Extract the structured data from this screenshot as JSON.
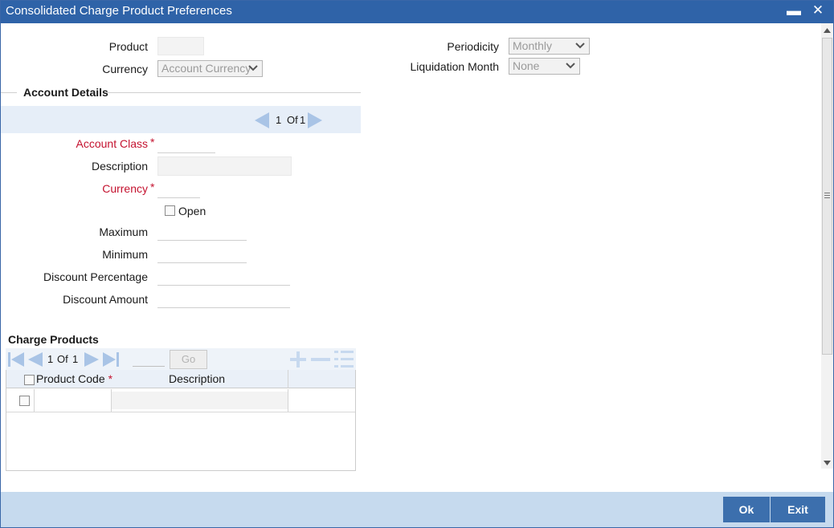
{
  "window": {
    "title": "Consolidated Charge Product Preferences",
    "minimize_glyph": "▬",
    "close_glyph": "✕"
  },
  "header_fields": {
    "product_label": "Product",
    "product_value": "",
    "currency_label": "Currency",
    "currency_selected": "Account Currency",
    "periodicity_label": "Periodicity",
    "periodicity_selected": "Monthly",
    "liquidation_month_label": "Liquidation Month",
    "liquidation_month_selected": "None"
  },
  "account_details": {
    "heading": "Account Details",
    "pager_current": "1",
    "pager_of": "Of",
    "pager_total": "1",
    "account_class_label": "Account Class",
    "description_label": "Description",
    "currency_label": "Currency",
    "open_label": "Open",
    "open_checked": false,
    "maximum_label": "Maximum",
    "minimum_label": "Minimum",
    "discount_percentage_label": "Discount Percentage",
    "discount_amount_label": "Discount Amount",
    "required_marker": "*"
  },
  "charge_products": {
    "heading": "Charge Products",
    "pager_current": "1",
    "pager_of": "Of",
    "pager_total": "1",
    "go_label": "Go",
    "columns": [
      "Product Code",
      "Description"
    ],
    "required_marker": "*",
    "rows": [
      {
        "product_code": "",
        "description": ""
      }
    ]
  },
  "footer": {
    "ok_label": "Ok",
    "exit_label": "Exit"
  },
  "colors": {
    "titlebar": "#2f63a8",
    "required": "#c4122f",
    "footer": "#c6daee",
    "button": "#3c6fad",
    "pager_arrow": "#a9c4e6"
  },
  "icons": [
    "minimize-icon",
    "close-icon",
    "prev-record-icon",
    "next-record-icon",
    "first-page-icon",
    "prev-page-icon",
    "next-page-icon",
    "last-page-icon",
    "add-row-icon",
    "delete-row-icon",
    "single-view-icon",
    "dropdown-arrow-icon",
    "scroll-up-icon",
    "scroll-down-icon"
  ]
}
